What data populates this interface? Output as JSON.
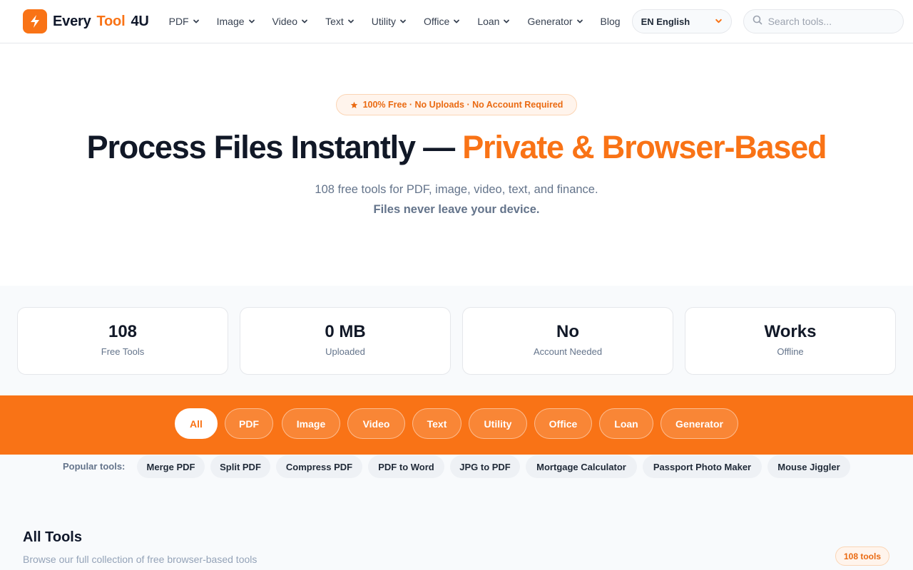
{
  "header": {
    "logo": {
      "word1": "Every",
      "word2": "Tool",
      "word3": "4U",
      "icon": "lightning-icon"
    },
    "nav": [
      {
        "label": "PDF",
        "has_dropdown": true
      },
      {
        "label": "Image",
        "has_dropdown": true
      },
      {
        "label": "Video",
        "has_dropdown": true
      },
      {
        "label": "Text",
        "has_dropdown": true
      },
      {
        "label": "Utility",
        "has_dropdown": true
      },
      {
        "label": "Office",
        "has_dropdown": true
      },
      {
        "label": "Loan",
        "has_dropdown": true
      },
      {
        "label": "Generator",
        "has_dropdown": true
      },
      {
        "label": "Blog",
        "has_dropdown": false
      }
    ],
    "language": {
      "selected": "EN English"
    },
    "search": {
      "placeholder": "Search tools...",
      "value": ""
    }
  },
  "hero": {
    "badge": "100% Free · No Uploads · No Account Required",
    "headline_main": "Process Files Instantly — ",
    "headline_accent": "Private & Browser-Based",
    "subtitle": "108 free tools for PDF, image, video, text, and finance.",
    "subtitle_bold": "Files never leave your device."
  },
  "stats": [
    {
      "value": "108",
      "label": "Free Tools"
    },
    {
      "value": "0 MB",
      "label": "Uploaded"
    },
    {
      "value": "No",
      "label": "Account Needed"
    },
    {
      "value": "Works",
      "label": "Offline"
    }
  ],
  "categories": {
    "active": "All",
    "items": [
      "All",
      "PDF",
      "Image",
      "Video",
      "Text",
      "Utility",
      "Office",
      "Loan",
      "Generator"
    ]
  },
  "popular": {
    "label": "Popular tools:",
    "items": [
      "Merge PDF",
      "Split PDF",
      "Compress PDF",
      "PDF to Word",
      "JPG to PDF",
      "Mortgage Calculator",
      "Passport Photo Maker",
      "Mouse Jiggler"
    ]
  },
  "all_tools": {
    "title": "All Tools",
    "subtitle": "Browse our full collection of free browser-based tools",
    "count": "108 tools"
  },
  "colors": {
    "accent": "#f97316",
    "text": "#0f172a",
    "muted": "#64748b"
  }
}
